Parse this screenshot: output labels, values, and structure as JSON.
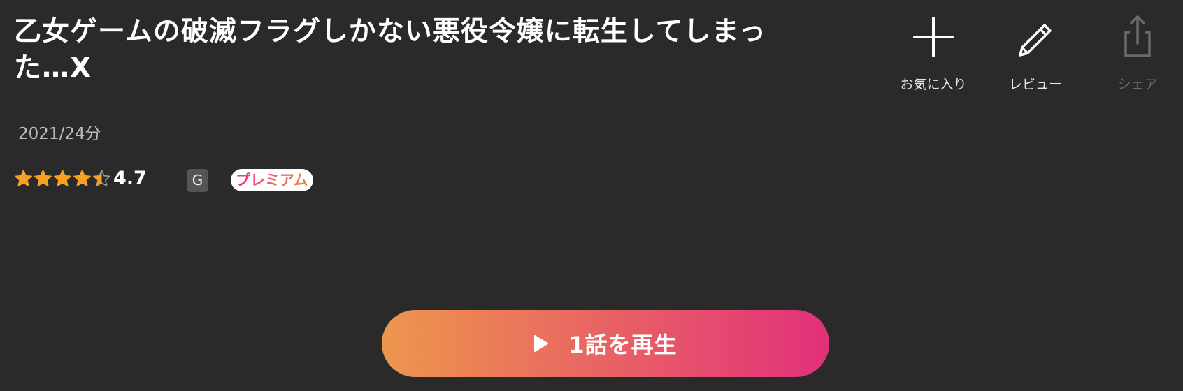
{
  "title": "乙女ゲームの破滅フラグしかない悪役令嬢に転生してしまった…X",
  "actions": {
    "favorite_label": "お気に入り",
    "review_label": "レビュー",
    "share_label": "シェア"
  },
  "meta": "2021/24分",
  "rating": {
    "stars": 4.5,
    "score": "4.7"
  },
  "badges": {
    "age_rating": "G",
    "premium": "プレミアム"
  },
  "play_button": {
    "label": "1話を再生"
  },
  "colors": {
    "background": "#2a2a2a",
    "star_fill": "#f6a025",
    "gradient_start": "#ee964c",
    "gradient_end": "#e2307b",
    "disabled": "#6a6a6a"
  },
  "icons": {
    "favorite": "plus-icon",
    "review": "pencil-icon",
    "share": "share-icon",
    "play": "play-icon"
  }
}
